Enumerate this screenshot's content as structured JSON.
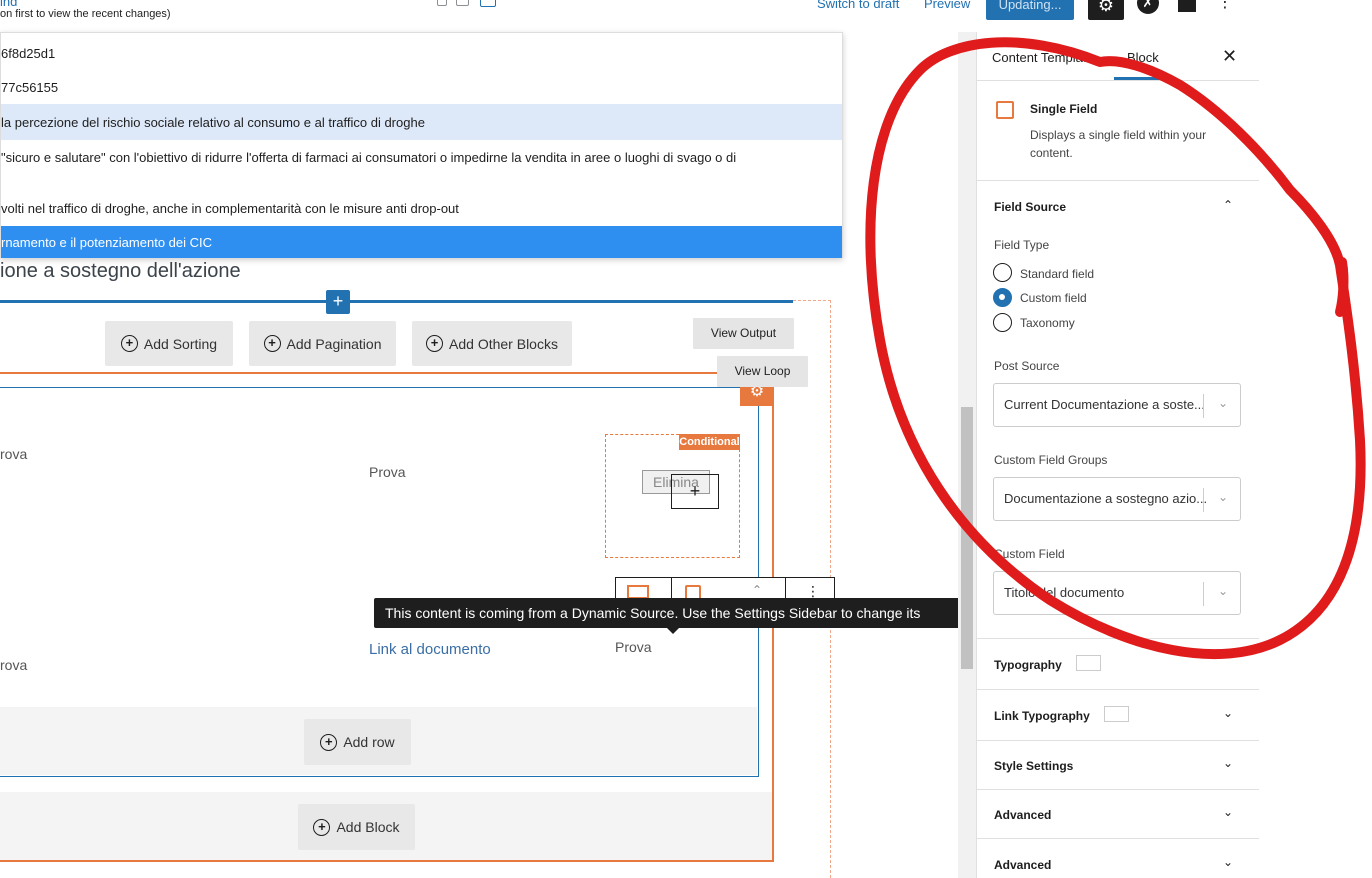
{
  "topbar": {
    "notice_link": "ind",
    "notice_text": "on first to view the recent changes)",
    "switch_to_draft": "Switch to draft",
    "preview": "Preview",
    "updating": "Updating..."
  },
  "dropdown": {
    "items": [
      "6f8d25d1",
      "77c56155",
      "la percezione del rischio sociale relativo al consumo e al traffico di droghe",
      "\"sicuro e salutare\" con l'obiettivo di ridurre l'offerta di farmaci ai consumatori o impedirne la vendita in aree o luoghi di svago o di",
      "volti nel traffico di droghe, anche in complementarità con le misure anti drop-out",
      "rnamento e il potenziamento dei CIC"
    ]
  },
  "editor": {
    "section_title": "ione a sostegno dell'azione",
    "add_sorting": "Add Sorting",
    "add_pagination": "Add Pagination",
    "add_other_blocks": "Add Other Blocks",
    "view_output": "View Output",
    "view_loop": "View Loop",
    "row1_col1": "rova",
    "row1_col2": "Prova",
    "conditional": "Conditional",
    "elimina": "Elimina",
    "row2_col1": "rova",
    "row2_link": "Link al documento",
    "row2_col3": "Prova",
    "tooltip": "This content is coming from a Dynamic Source. Use the Settings Sidebar to change its source.",
    "add_row": "Add row",
    "add_block": "Add Block"
  },
  "sidebar": {
    "tab_template": "Content Template",
    "tab_block": "Block",
    "block_name": "Single Field",
    "block_desc": "Displays a single field within your content.",
    "field_source": "Field Source",
    "field_type_label": "Field Type",
    "field_type_options": [
      "Standard field",
      "Custom field",
      "Taxonomy"
    ],
    "field_type_selected": "Custom field",
    "post_source_label": "Post Source",
    "post_source_value": "Current Documentazione a soste...",
    "custom_field_groups_label": "Custom Field Groups",
    "custom_field_groups_value": "Documentazione a sostegno azio...",
    "custom_field_label": "Custom Field",
    "custom_field_value": "Titolo del documento",
    "panels": [
      "Typography",
      "Link Typography",
      "Style Settings",
      "Advanced",
      "Advanced"
    ]
  },
  "colors": {
    "wp_blue": "#2271b1",
    "orange": "#e8793e",
    "annotation_red": "#e01b1b"
  }
}
